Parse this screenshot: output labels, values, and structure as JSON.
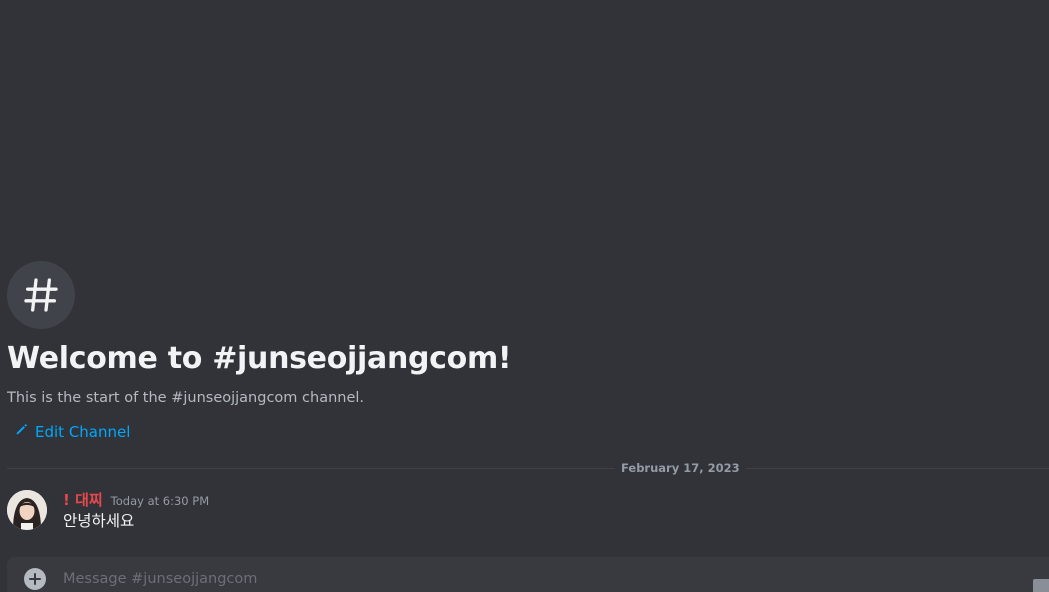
{
  "channel": {
    "welcome_title": "Welcome to #junseojjangcom!",
    "welcome_subtitle": "This is the start of the #junseojjangcom channel.",
    "edit_label": "Edit Channel"
  },
  "divider": {
    "date": "February 17, 2023"
  },
  "messages": [
    {
      "username": "! 대찌",
      "timestamp": "Today at 6:30 PM",
      "text": "안녕하세요"
    }
  ],
  "composer": {
    "placeholder": "Message #junseojjangcom"
  },
  "icons": {
    "channel": "hash-icon",
    "edit": "pencil-icon",
    "attach": "plus-icon"
  },
  "colors": {
    "background": "#313338",
    "link": "#00a8fc",
    "username": "#e5484d"
  }
}
